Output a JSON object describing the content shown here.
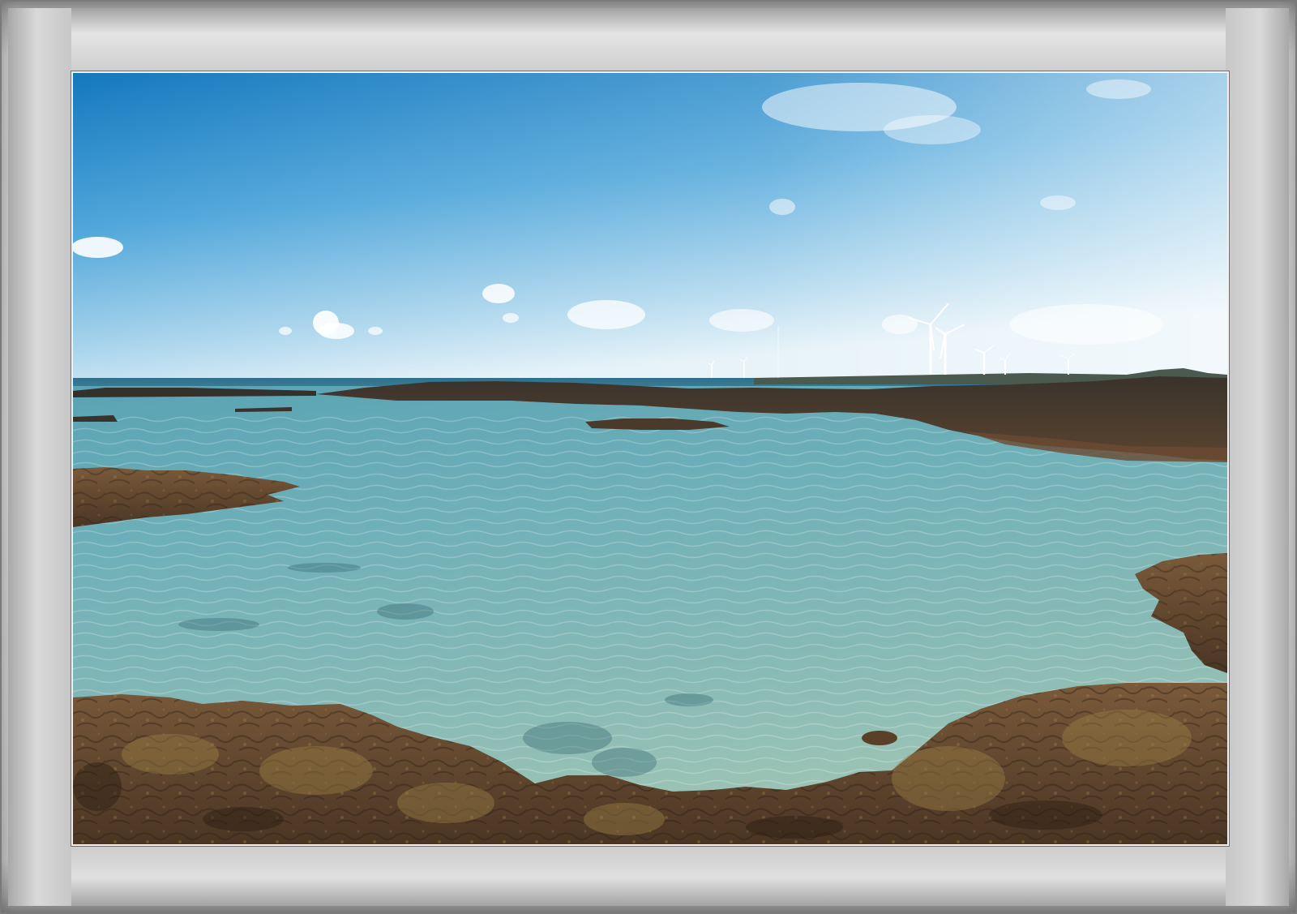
{
  "scene": {
    "sky_top_color": "#1f86c9",
    "sky_horizon_color": "#e6f2f8",
    "sea_far_color": "#3d7f9a",
    "water_near_color": "#7fb3b4",
    "rock_color": "#6b4e35",
    "rock_dark_color": "#2f2b27",
    "turbine_color": "#ffffff",
    "elements": [
      "sky",
      "clouds",
      "horizon-sea",
      "wind-turbines",
      "breakwater-rocks",
      "tide-pool",
      "foreground-rocks"
    ]
  },
  "frame": {
    "style": "bevelled-gray",
    "color": "#c8c8c8"
  }
}
